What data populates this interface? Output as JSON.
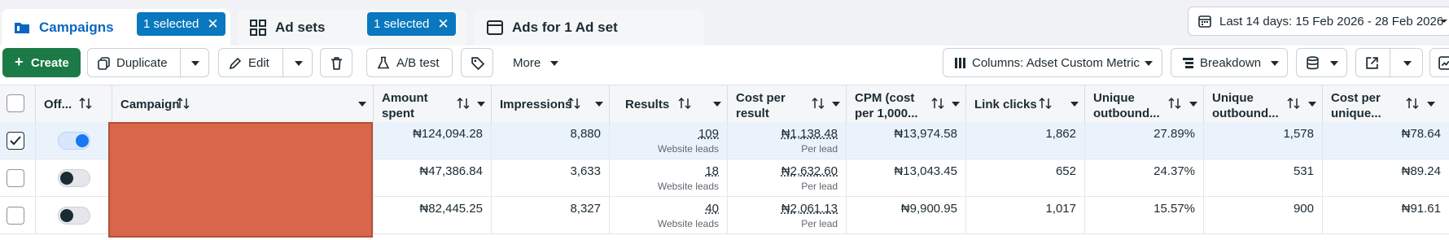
{
  "tabs": [
    {
      "label": "Campaigns",
      "icon": "folder-icon",
      "badge": "1 selected"
    },
    {
      "label": "Ad sets",
      "icon": "grid-icon",
      "badge": "1 selected"
    },
    {
      "label": "Ads for 1 Ad set",
      "icon": "ad-window-icon"
    }
  ],
  "date_range": "Last 14 days: 15 Feb 2026 - 28 Feb 2026",
  "toolbar": {
    "create": "Create",
    "duplicate": "Duplicate",
    "edit": "Edit",
    "ab_test": "A/B test",
    "more": "More",
    "columns": "Columns: Adset Custom Metric",
    "breakdown": "Breakdown"
  },
  "table": {
    "columns": [
      {
        "label": "Off..."
      },
      {
        "label": "Campaign"
      },
      {
        "label": "Amount spent"
      },
      {
        "label": "Impressions"
      },
      {
        "label": "Results"
      },
      {
        "label": "Cost per result"
      },
      {
        "label": "CPM (cost per 1,000..."
      },
      {
        "label": "Link clicks"
      },
      {
        "label": "Unique outbound..."
      },
      {
        "label": "Unique outbound..."
      },
      {
        "label": "Cost per unique..."
      }
    ],
    "rows": [
      {
        "checked": true,
        "on": true,
        "amount": "₦124,094.28",
        "impressions": "8,880",
        "results": "109",
        "results_sub": "Website leads",
        "cpr": "₦1,138.48",
        "cpr_sub": "Per lead",
        "cpm": "₦13,974.58",
        "link_clicks": "1,862",
        "uo_pct": "27.89%",
        "uo_count": "1,578",
        "cpu": "₦78.64"
      },
      {
        "checked": false,
        "on": false,
        "amount": "₦47,386.84",
        "impressions": "3,633",
        "results": "18",
        "results_sub": "Website leads",
        "cpr": "₦2,632.60",
        "cpr_sub": "Per lead",
        "cpm": "₦13,043.45",
        "link_clicks": "652",
        "uo_pct": "24.37%",
        "uo_count": "531",
        "cpu": "₦89.24"
      },
      {
        "checked": false,
        "on": false,
        "amount": "₦82,445.25",
        "impressions": "8,327",
        "results": "40",
        "results_sub": "Website leads",
        "cpr": "₦2,061.13",
        "cpr_sub": "Per lead",
        "cpm": "₦9,900.95",
        "link_clicks": "1,017",
        "uo_pct": "15.57%",
        "uo_count": "900",
        "cpu": "₦91.61"
      }
    ]
  },
  "colors": {
    "accent": "#0a66c2",
    "badge": "#0a78be",
    "create": "#1b7a46",
    "redaction": "#d9664a",
    "toggle_on": "#1877f2"
  }
}
